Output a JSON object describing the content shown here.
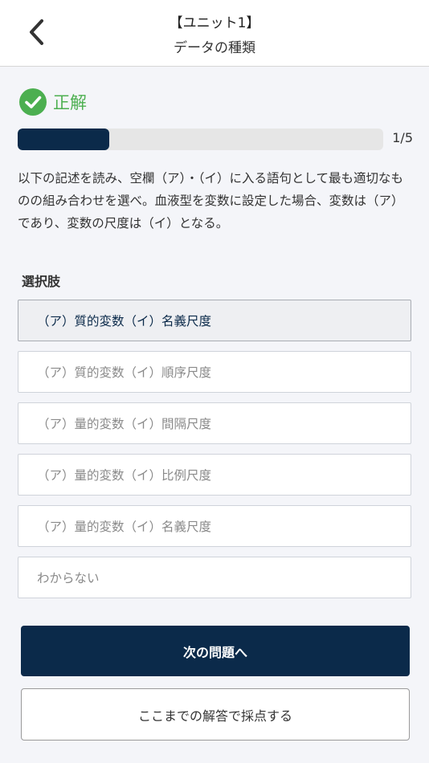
{
  "header": {
    "title": "【ユニット1】",
    "subtitle": "データの種類",
    "back_icon": "chevron-left-icon"
  },
  "result": {
    "icon": "check-circle-icon",
    "label": "正解",
    "color": "#4caf50"
  },
  "progress": {
    "current": 1,
    "total": 5,
    "fraction": 0.25,
    "text": "1/5",
    "fill_color": "#0b2a4a"
  },
  "question": {
    "text": "以下の記述を読み、空欄（ア）・（イ）に入る語句として最も適切なものの組み合わせを選べ。血液型を変数に設定した場合、変数は（ア）であり、変数の尺度は（イ）となる。"
  },
  "choices": {
    "label": "選択肢",
    "items": [
      {
        "label": "（ア）質的変数（イ）名義尺度",
        "selected": true
      },
      {
        "label": "（ア）質的変数（イ）順序尺度",
        "selected": false
      },
      {
        "label": "（ア）量的変数（イ）間隔尺度",
        "selected": false
      },
      {
        "label": "（ア）量的変数（イ）比例尺度",
        "selected": false
      },
      {
        "label": "（ア）量的変数（イ）名義尺度",
        "selected": false
      },
      {
        "label": "わからない",
        "selected": false
      }
    ]
  },
  "actions": {
    "next_label": "次の問題へ",
    "grade_label": "ここまでの解答で採点する"
  },
  "colors": {
    "primary": "#0b2a4a",
    "success": "#4caf50",
    "background": "#f4f5f9"
  }
}
